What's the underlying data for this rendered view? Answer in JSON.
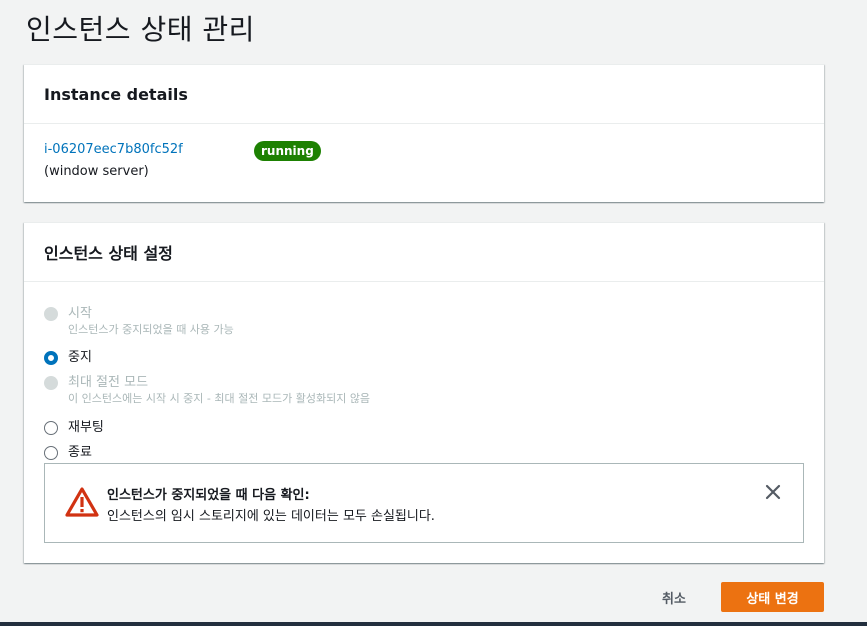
{
  "page": {
    "title": "인스턴스 상태 관리"
  },
  "details": {
    "header": "Instance details",
    "instance_id": "i-06207eec7b80fc52f",
    "instance_name": "(window server)",
    "status": "running",
    "status_color": "#1d8102"
  },
  "state": {
    "header": "인스턴스 상태 설정",
    "options": [
      {
        "label": "시작",
        "description": "인스턴스가 중지되었을 때 사용 가능",
        "disabled": true,
        "checked": false
      },
      {
        "label": "중지",
        "description": "",
        "disabled": false,
        "checked": true
      },
      {
        "label": "최대 절전 모드",
        "description": "이 인스턴스에는 시작 시 중지 - 최대 절전 모드가 활성화되지 않음",
        "disabled": true,
        "checked": false
      },
      {
        "label": "재부팅",
        "description": "",
        "disabled": false,
        "checked": false
      },
      {
        "label": "종료",
        "description": "",
        "disabled": false,
        "checked": false
      }
    ]
  },
  "alert": {
    "title": "인스턴스가 중지되었을 때 다음 확인:",
    "body": "인스턴스의 임시 스토리지에 있는 데이터는 모두 손실됩니다.",
    "icon": "warning-icon",
    "icon_color": "#d13212"
  },
  "actions": {
    "cancel_label": "취소",
    "submit_label": "상태 변경",
    "accent_color": "#ec7211"
  }
}
